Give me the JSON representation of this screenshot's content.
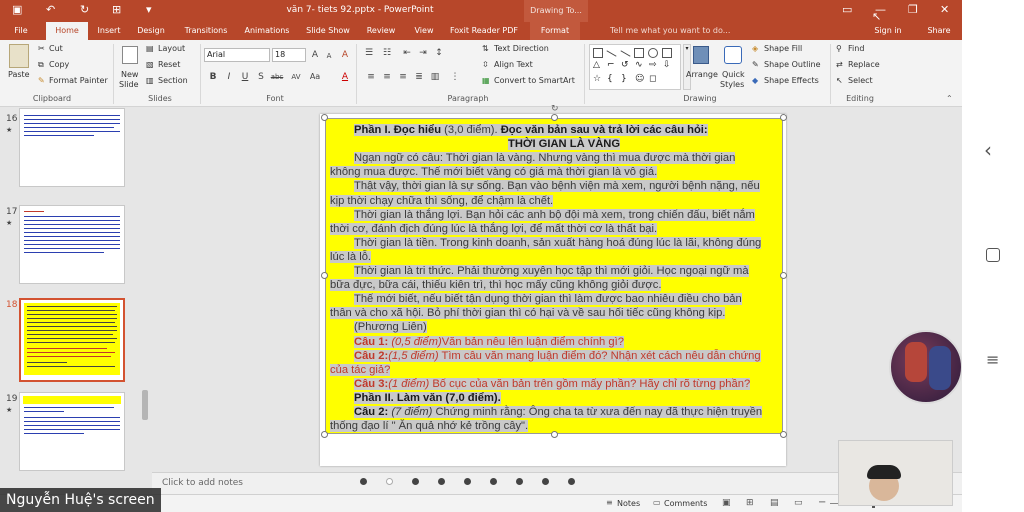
{
  "window": {
    "title": "văn 7- tiets 92.pptx - PowerPoint",
    "contextual_tab_group": "Drawing To...",
    "sign_in": "Sign in",
    "share": "Share"
  },
  "tabs": [
    {
      "label": "File",
      "active": false
    },
    {
      "label": "Home",
      "active": true
    },
    {
      "label": "Insert",
      "active": false
    },
    {
      "label": "Design",
      "active": false
    },
    {
      "label": "Transitions",
      "active": false
    },
    {
      "label": "Animations",
      "active": false
    },
    {
      "label": "Slide Show",
      "active": false
    },
    {
      "label": "Review",
      "active": false
    },
    {
      "label": "View",
      "active": false
    },
    {
      "label": "Foxit Reader PDF",
      "active": false
    },
    {
      "label": "Format",
      "active": false
    }
  ],
  "tell_me": "Tell me what you want to do...",
  "ribbon": {
    "clipboard": {
      "paste": "Paste",
      "cut": "Cut",
      "copy": "Copy",
      "format_painter": "Format Painter",
      "group": "Clipboard"
    },
    "slides": {
      "new_slide": "New",
      "new_slide2": "Slide",
      "layout": "Layout",
      "reset": "Reset",
      "section": "Section",
      "group": "Slides"
    },
    "font": {
      "name": "Arial",
      "size": "18",
      "group": "Font",
      "bold": "B",
      "italic": "I",
      "underline": "U",
      "shadow": "S",
      "strike": "abc",
      "spacing": "AV",
      "case": "Aa",
      "grow": "A",
      "shrink": "A",
      "clear": "A",
      "color": "A"
    },
    "paragraph": {
      "text_direction": "Text Direction",
      "align_text": "Align Text",
      "smartart": "Convert to SmartArt",
      "group": "Paragraph"
    },
    "drawing": {
      "arrange": "Arrange",
      "quick_styles": "Quick",
      "quick_styles2": "Styles",
      "shape_fill": "Shape Fill",
      "shape_outline": "Shape Outline",
      "shape_effects": "Shape Effects",
      "group": "Drawing"
    },
    "editing": {
      "find": "Find",
      "replace": "Replace",
      "select": "Select",
      "group": "Editing"
    }
  },
  "thumbnails": [
    {
      "number": "16",
      "selected": false
    },
    {
      "number": "17",
      "selected": false
    },
    {
      "number": "18",
      "selected": true
    },
    {
      "number": "19",
      "selected": false
    }
  ],
  "slide": {
    "lines": [
      [
        {
          "t": "Phần I. Đọc hiểu ",
          "s": "b"
        },
        {
          "t": "(3,0 điểm). ",
          "s": ""
        },
        {
          "t": "Đọc văn bản sau và trả lời các câu hỏi:",
          "s": "b"
        }
      ],
      [
        {
          "t": "THỜI GIAN LÀ VÀNG",
          "s": "b"
        }
      ],
      [
        {
          "t": "Ngạn ngữ có câu: Thời gian là vàng. Nhưng vàng thì mua được mà thời gian",
          "s": ""
        }
      ],
      [
        {
          "t": "không mua được. Thế mới biết vàng có giá mà thời gian là vô giá.",
          "s": ""
        }
      ],
      [
        {
          "t": "Thật vậy, thời gian là sự sống. Bạn vào bệnh viện mà xem, người bệnh nặng, nếu",
          "s": ""
        }
      ],
      [
        {
          "t": "kịp thời chạy chữa thì sống, để chậm là chết.",
          "s": ""
        }
      ],
      [
        {
          "t": "Thời gian là thắng lợi. Bạn hỏi các anh bộ đội mà xem, trong chiến đấu, biết nắm",
          "s": ""
        }
      ],
      [
        {
          "t": "thời cơ, đánh địch đúng lúc là thắng lợi, để mất thời cơ là thất bại.",
          "s": ""
        }
      ],
      [
        {
          "t": "Thời gian là tiền. Trong kinh doanh, sản xuất hàng hoá đúng lúc là lãi, không đúng",
          "s": ""
        }
      ],
      [
        {
          "t": "lúc là lỗ.",
          "s": ""
        }
      ],
      [
        {
          "t": "Thời gian là tri thức. Phải thường xuyên học tập thì mới giỏi. Học ngoại ngữ mà",
          "s": ""
        }
      ],
      [
        {
          "t": "bữa đực, bữa cái, thiếu kiên trì, thì học mấy cũng không giỏi được.",
          "s": ""
        }
      ],
      [
        {
          "t": "Thế mới biết, nếu biết tận dụng thời gian thì làm được bao nhiêu điều cho bản",
          "s": ""
        }
      ],
      [
        {
          "t": "thân và cho xã hội. Bỏ phí thời gian thì có hại và về sau hối tiếc cũng không kịp.",
          "s": ""
        }
      ],
      [
        {
          "t": "(Phương Liên)",
          "s": ""
        }
      ],
      [
        {
          "t": "Câu 1: ",
          "s": "rb"
        },
        {
          "t": "(0,5 điểm)",
          "s": "ri"
        },
        {
          "t": "Văn bản nêu lên luận điểm chính gì?",
          "s": "r"
        }
      ],
      [
        {
          "t": "Câu 2:",
          "s": "rb"
        },
        {
          "t": "(1,5 điểm)",
          "s": "ri"
        },
        {
          "t": " Tìm câu văn mang luận điểm đó? Nhận xét cách nêu dẫn chứng",
          "s": "r"
        }
      ],
      [
        {
          "t": "của tác giả?",
          "s": "r"
        }
      ],
      [
        {
          "t": "Câu 3:",
          "s": "rb"
        },
        {
          "t": "(1 điểm)",
          "s": "ri"
        },
        {
          "t": " Bố cục của văn bản trên gồm mấy phần? Hãy chỉ rõ từng phần?",
          "s": "r"
        }
      ],
      [
        {
          "t": "Phần II. Làm văn ",
          "s": "b"
        },
        {
          "t": "(7,0 điểm).",
          "s": "b"
        }
      ],
      [
        {
          "t": "Câu 2: ",
          "s": "b"
        },
        {
          "t": "(7 điểm)",
          "s": "i"
        },
        {
          "t": " Chứng minh rằng: Ông cha ta từ xưa đến nay đã thực hiện truyền",
          "s": ""
        }
      ],
      [
        {
          "t": "thống đạo lí \" Ăn quả nhớ kẻ trồng cây\".",
          "s": ""
        }
      ]
    ]
  },
  "notes_placeholder": "Click to add notes",
  "status": {
    "notes": "Notes",
    "comments": "Comments"
  },
  "overlay": {
    "screen_label": "Nguyễn Huệ's screen"
  }
}
